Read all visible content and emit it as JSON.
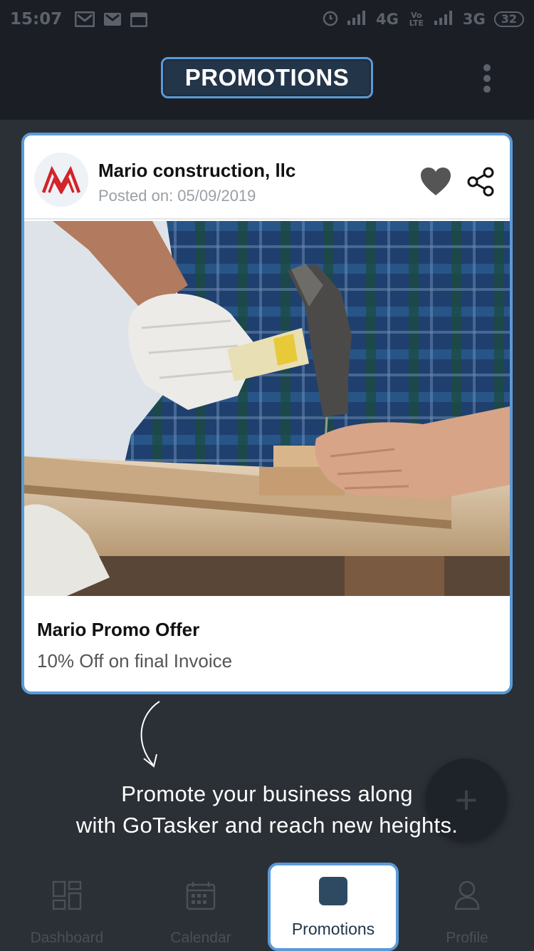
{
  "status_bar": {
    "time": "15:07",
    "network_1": "4G",
    "network_2": "3G",
    "volte": "Vo LTE",
    "battery": "32"
  },
  "header": {
    "title": "PROMOTIONS"
  },
  "card": {
    "company": "Mario construction, llc",
    "posted": "Posted on: 05/09/2019",
    "promo_title": "Mario Promo Offer",
    "promo_subtitle": "10% Off on final Invoice"
  },
  "overlay": {
    "line1": "Promote your business along",
    "line2": "with GoTasker and reach new heights."
  },
  "fab": {
    "label": "+"
  },
  "bottom_nav": {
    "items": [
      {
        "label": "Dashboard",
        "icon": "dashboard-icon"
      },
      {
        "label": "Calendar",
        "icon": "calendar-icon"
      },
      {
        "label": "Promotions",
        "icon": "promotions-icon",
        "active": true
      },
      {
        "label": "Profile",
        "icon": "profile-icon"
      }
    ]
  },
  "colors": {
    "accent": "#5a9ad6",
    "background": "#2b2f36",
    "header_bg": "#1b1f25"
  }
}
